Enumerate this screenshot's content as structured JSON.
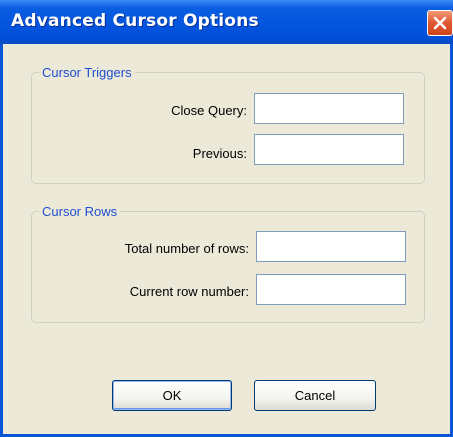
{
  "window": {
    "title": "Advanced Cursor Options"
  },
  "cursor_triggers": {
    "group_label": "Cursor Triggers",
    "close_query_label": "Close Query:",
    "close_query_value": "",
    "previous_label": "Previous:",
    "previous_value": ""
  },
  "cursor_rows": {
    "group_label": "Cursor Rows",
    "total_rows_label": "Total number of rows:",
    "total_rows_value": "",
    "current_row_label": "Current row number:",
    "current_row_value": ""
  },
  "buttons": {
    "ok_label": "OK",
    "cancel_label": "Cancel"
  },
  "icons": {
    "close": "close-icon"
  },
  "colors": {
    "titlebar": "#0454e0",
    "group_label": "#1f4ed2",
    "dialog_background": "#ece9d8",
    "close_button": "#e0582f"
  }
}
